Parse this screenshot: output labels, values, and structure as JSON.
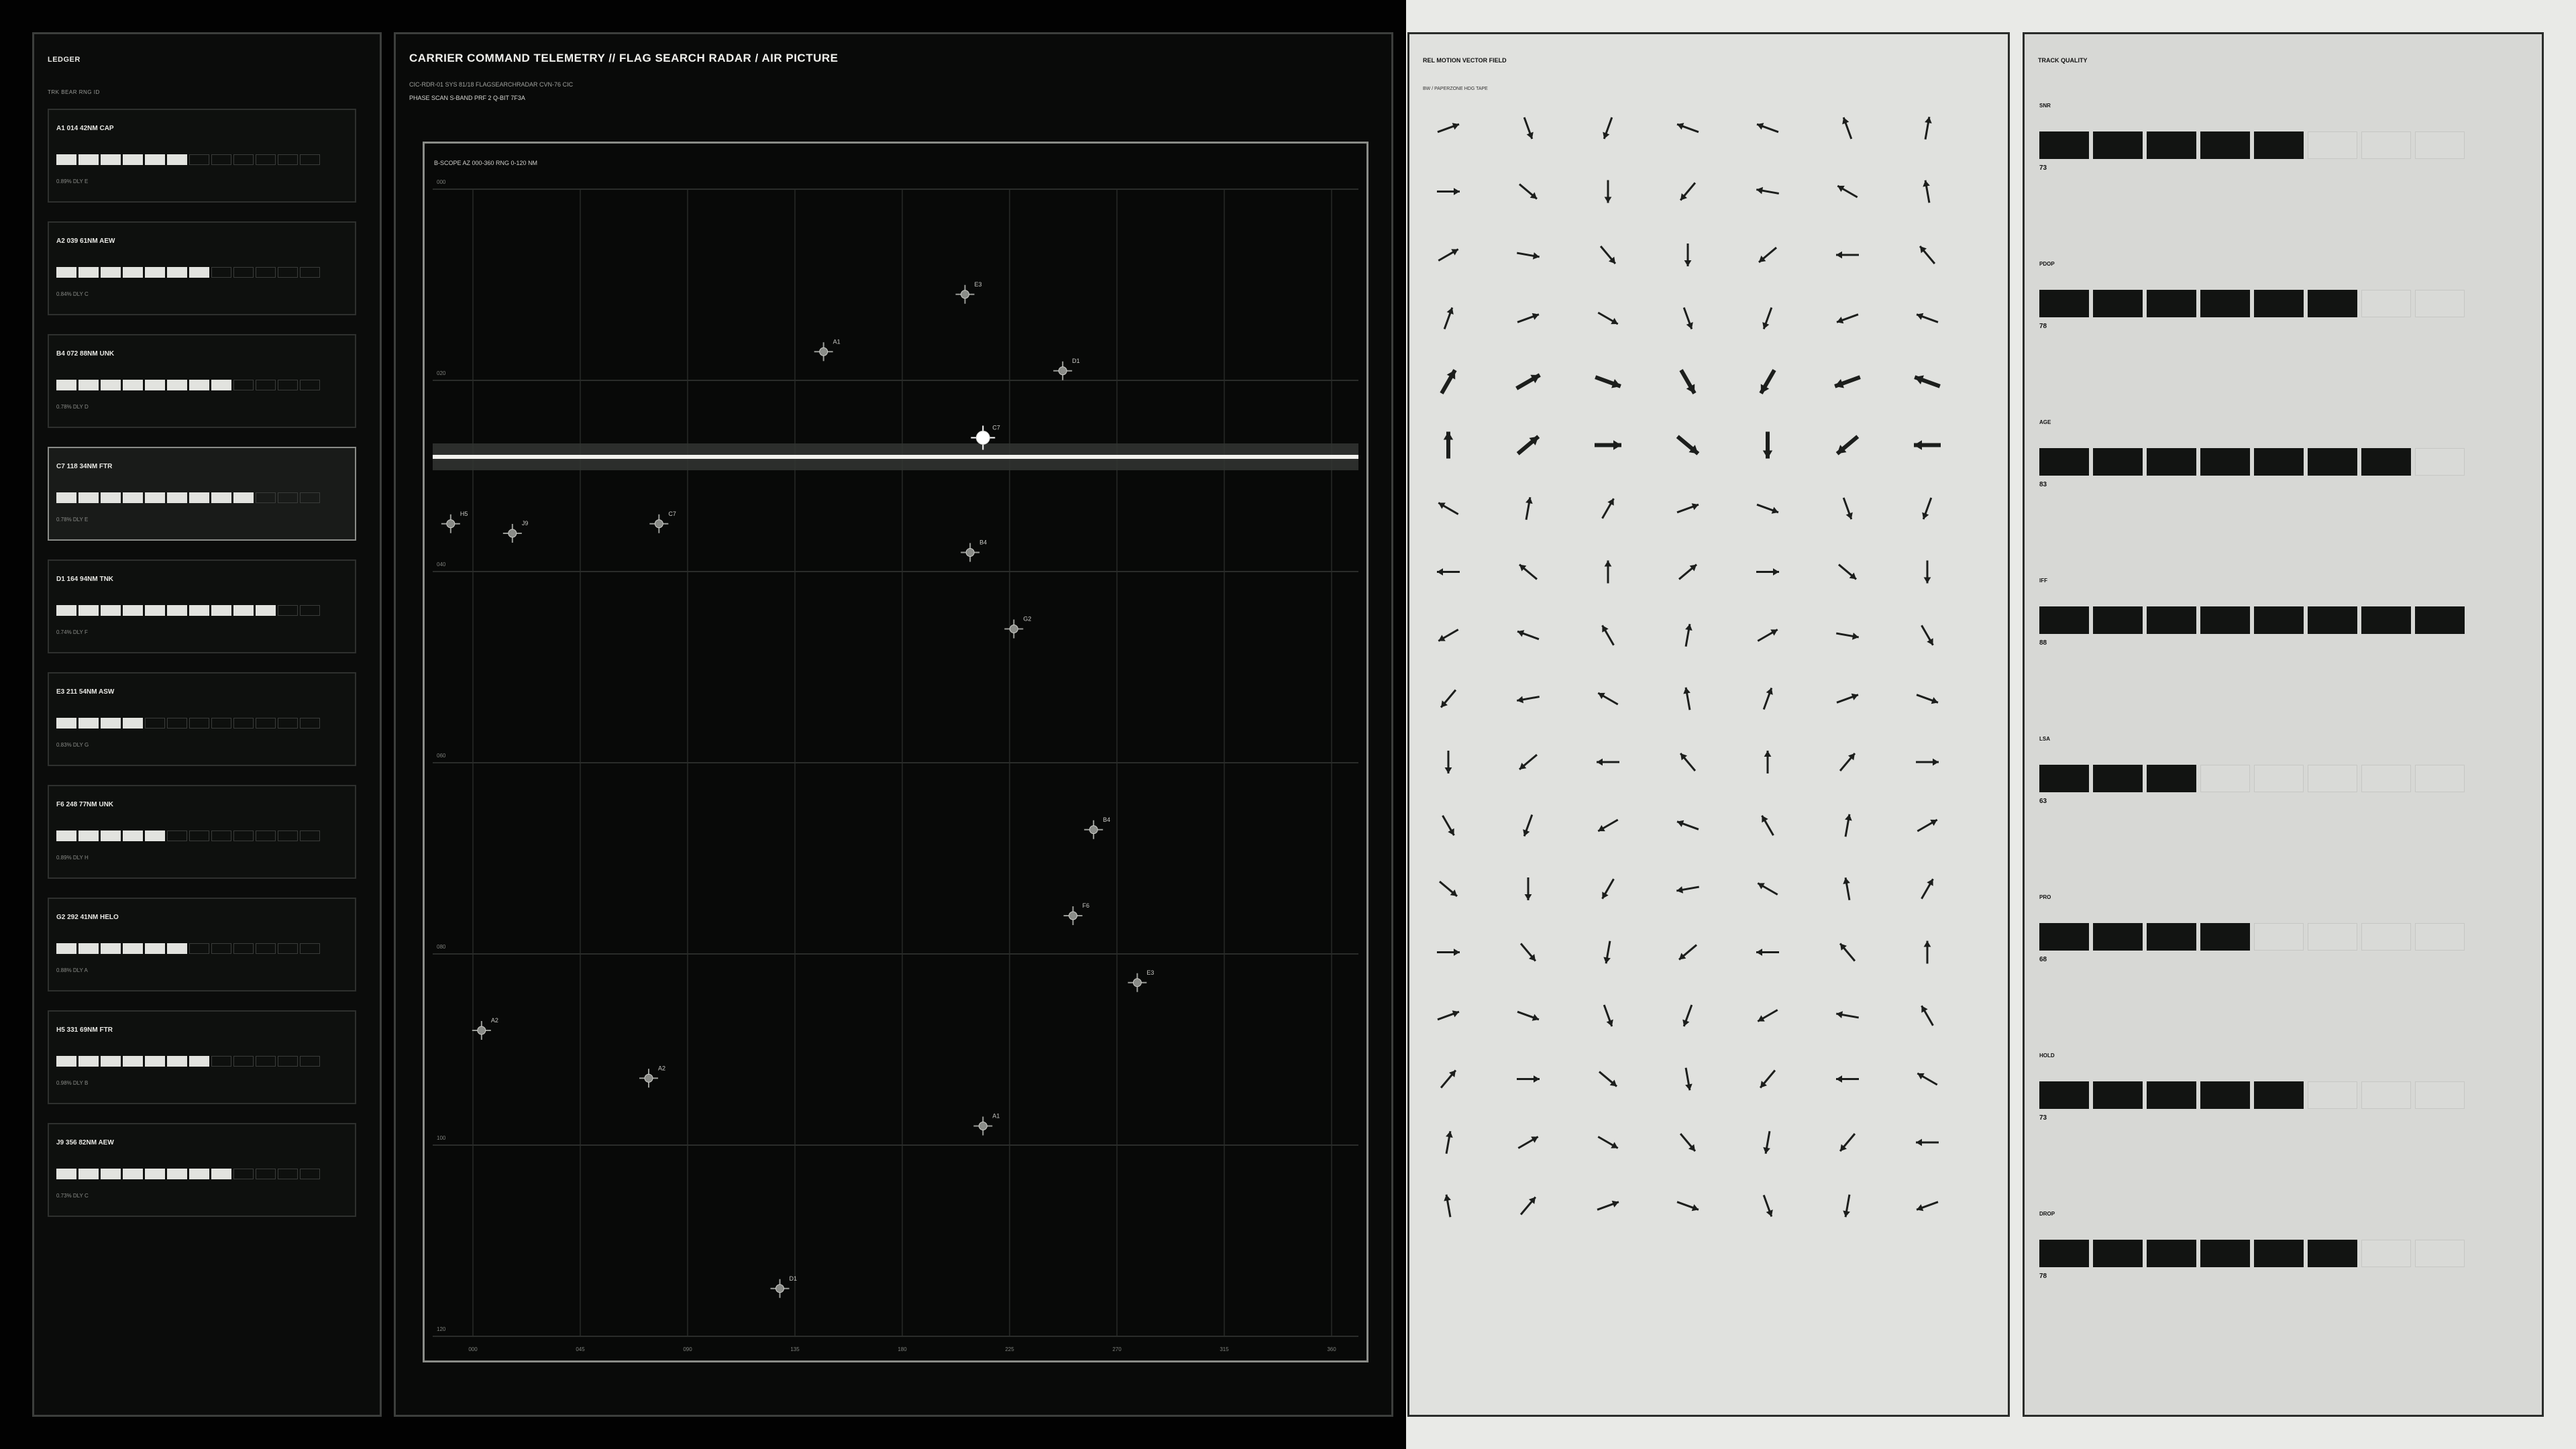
{
  "colors": {
    "panel_dark": "#0b0c0b",
    "panel_light": "#e0e1de",
    "accent": "#e8e8e4",
    "ink": "#121412"
  },
  "ledger": {
    "title": "LEDGER",
    "subtitle": "TRK BEAR RNG ID",
    "cards": [
      {
        "id": "A1 014 42NM CAP",
        "filled": 6,
        "meta": "0.89%  DLY E",
        "selected": false
      },
      {
        "id": "A2 039 61NM AEW",
        "filled": 7,
        "meta": "0.84%  DLY C",
        "selected": false
      },
      {
        "id": "B4 072 88NM UNK",
        "filled": 8,
        "meta": "0.78%  DLY D",
        "selected": false
      },
      {
        "id": "C7 118 34NM FTR",
        "filled": 9,
        "meta": "0.78%  DLY E",
        "selected": true
      },
      {
        "id": "D1 164 94NM TNK",
        "filled": 10,
        "meta": "0.74%  DLY F",
        "selected": false
      },
      {
        "id": "E3 211 54NM ASW",
        "filled": 4,
        "meta": "0.83%  DLY G",
        "selected": false
      },
      {
        "id": "F6 248 77NM UNK",
        "filled": 5,
        "meta": "0.89%  DLY H",
        "selected": false
      },
      {
        "id": "G2 292 41NM HELO",
        "filled": 6,
        "meta": "0.88%  DLY A",
        "selected": false
      },
      {
        "id": "H5 331 69NM FTR",
        "filled": 7,
        "meta": "0.98%  DLY B",
        "selected": false
      },
      {
        "id": "J9 356 82NM AEW",
        "filled": 8,
        "meta": "0.73%  DLY C",
        "selected": false
      }
    ]
  },
  "main": {
    "title": "CARRIER COMMAND TELEMETRY  //  FLAG SEARCH RADAR / AIR PICTURE",
    "sub1": "CIC-RDR-01   SYS 81/18   FLAGSEARCHRADAR   CVN-76  CIC",
    "sub2": "PHASE SCAN   S-BAND   PRF 2   Q-BIT 7F3A",
    "scope_label": "B-SCOPE  AZ 000-360  RNG 0-120 NM",
    "y_ticks": [
      "000",
      "020",
      "040",
      "060",
      "080",
      "100",
      "120"
    ],
    "x_ticks": [
      "000",
      "045",
      "090",
      "135",
      "180",
      "225",
      "270",
      "315",
      "360"
    ]
  },
  "chart_data": {
    "type": "scatter",
    "xlabel": "AZ",
    "ylabel": "RNG",
    "xlim": [
      0,
      360
    ],
    "ylim": [
      0,
      120
    ],
    "sweep_range": 28,
    "points": [
      {
        "label": "E3",
        "az": 207,
        "rng": 11,
        "selected": false
      },
      {
        "label": "A1",
        "az": 152,
        "rng": 17,
        "selected": false
      },
      {
        "label": "D1",
        "az": 245,
        "rng": 19,
        "selected": false
      },
      {
        "label": "C7",
        "az": 214,
        "rng": 26,
        "selected": true
      },
      {
        "label": "H5",
        "az": 7,
        "rng": 35,
        "selected": false
      },
      {
        "label": "J9",
        "az": 31,
        "rng": 36,
        "selected": false
      },
      {
        "label": "C7",
        "az": 88,
        "rng": 35,
        "selected": false
      },
      {
        "label": "B4",
        "az": 209,
        "rng": 38,
        "selected": false
      },
      {
        "label": "G2",
        "az": 226,
        "rng": 46,
        "selected": false
      },
      {
        "label": "B4",
        "az": 257,
        "rng": 67,
        "selected": false
      },
      {
        "label": "F6",
        "az": 249,
        "rng": 76,
        "selected": false
      },
      {
        "label": "E3",
        "az": 274,
        "rng": 83,
        "selected": false
      },
      {
        "label": "A2",
        "az": 19,
        "rng": 88,
        "selected": false
      },
      {
        "label": "A2",
        "az": 84,
        "rng": 93,
        "selected": false
      },
      {
        "label": "A1",
        "az": 214,
        "rng": 98,
        "selected": false
      },
      {
        "label": "D1",
        "az": 135,
        "rng": 115,
        "selected": false
      }
    ]
  },
  "vector_field": {
    "title": "REL MOTION VECTOR FIELD",
    "subtitle": "BW / PAPERZONE  HDG TAPE",
    "cols": 7,
    "rows": 18,
    "angles": [
      [
        -20,
        70,
        110,
        200,
        200,
        250,
        280
      ],
      [
        0,
        40,
        90,
        130,
        190,
        210,
        260
      ],
      [
        -30,
        10,
        50,
        90,
        140,
        180,
        230
      ],
      [
        -70,
        -20,
        30,
        70,
        110,
        160,
        200
      ],
      [
        -60,
        -30,
        20,
        60,
        120,
        160,
        200
      ],
      [
        -90,
        -40,
        0,
        40,
        90,
        140,
        180
      ],
      [
        210,
        280,
        300,
        -20,
        20,
        70,
        110
      ],
      [
        180,
        220,
        270,
        320,
        0,
        40,
        90
      ],
      [
        150,
        200,
        240,
        280,
        330,
        10,
        60
      ],
      [
        130,
        170,
        210,
        260,
        290,
        340,
        20
      ],
      [
        90,
        140,
        180,
        230,
        270,
        310,
        0
      ],
      [
        60,
        110,
        150,
        200,
        240,
        280,
        330
      ],
      [
        40,
        90,
        120,
        170,
        210,
        260,
        300
      ],
      [
        0,
        50,
        100,
        140,
        180,
        230,
        270
      ],
      [
        -20,
        20,
        70,
        110,
        150,
        190,
        240
      ],
      [
        -50,
        0,
        40,
        80,
        130,
        180,
        210
      ],
      [
        -80,
        -30,
        30,
        50,
        100,
        130,
        180
      ],
      [
        -100,
        -50,
        -20,
        20,
        70,
        100,
        160
      ]
    ],
    "bold_rows": [
      4,
      5
    ]
  },
  "track_quality": {
    "title": "TRACK QUALITY",
    "segments": 8,
    "metrics": [
      {
        "name": "SNR",
        "filled": 5,
        "value": "73"
      },
      {
        "name": "PDOP",
        "filled": 6,
        "value": "78"
      },
      {
        "name": "AGE",
        "filled": 7,
        "value": "83"
      },
      {
        "name": "IFF",
        "filled": 8,
        "value": "88"
      },
      {
        "name": "LSA",
        "filled": 3,
        "value": "63"
      },
      {
        "name": "PRO",
        "filled": 4,
        "value": "68"
      },
      {
        "name": "HOLD",
        "filled": 5,
        "value": "73"
      },
      {
        "name": "DROP",
        "filled": 6,
        "value": "78"
      }
    ]
  }
}
